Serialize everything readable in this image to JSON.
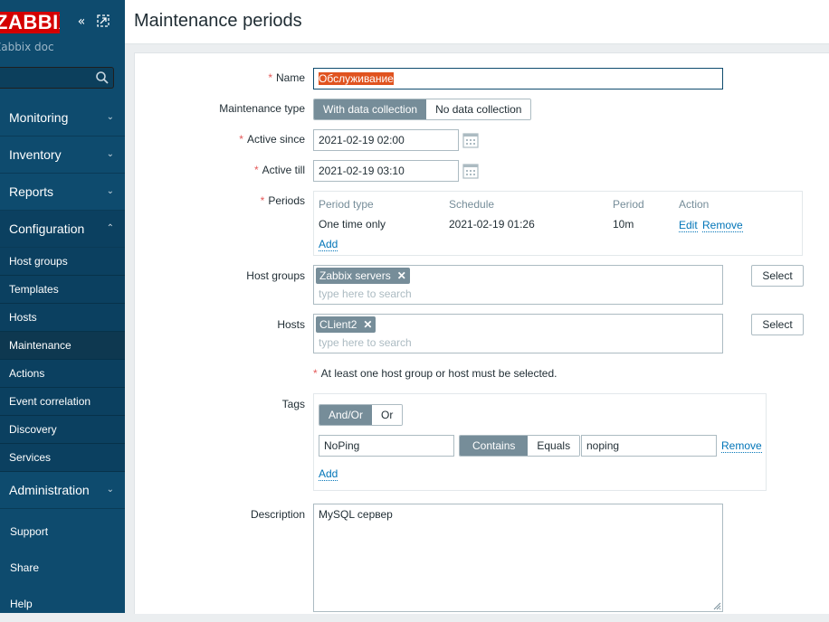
{
  "sidebar": {
    "logo": "ZABBIX",
    "server_name": "Zabbix docker",
    "menu": [
      {
        "label": "Monitoring"
      },
      {
        "label": "Inventory"
      },
      {
        "label": "Reports"
      },
      {
        "label": "Configuration"
      }
    ],
    "config_items": [
      {
        "label": "Host groups"
      },
      {
        "label": "Templates"
      },
      {
        "label": "Hosts"
      },
      {
        "label": "Maintenance"
      },
      {
        "label": "Actions"
      },
      {
        "label": "Event correlation"
      },
      {
        "label": "Discovery"
      },
      {
        "label": "Services"
      }
    ],
    "administration": "Administration",
    "bottom": [
      {
        "label": "Support"
      },
      {
        "label": "Share"
      },
      {
        "label": "Help"
      }
    ]
  },
  "header": {
    "title": "Maintenance periods"
  },
  "form": {
    "name_label": "Name",
    "name_value": "Обслуживание",
    "type_label": "Maintenance type",
    "type_options": [
      "With data collection",
      "No data collection"
    ],
    "type_selected": "With data collection",
    "since_label": "Active since",
    "since_value": "2021-02-19 02:00",
    "till_label": "Active till",
    "till_value": "2021-02-19 03:10",
    "periods_label": "Periods",
    "periods": {
      "headers": [
        "Period type",
        "Schedule",
        "Period",
        "Action"
      ],
      "rows": [
        {
          "type": "One time only",
          "schedule": "2021-02-19 01:26",
          "period": "10m",
          "edit": "Edit",
          "remove": "Remove"
        }
      ],
      "add": "Add"
    },
    "hostgroups_label": "Host groups",
    "hostgroups_chip": "Zabbix servers",
    "hostgroups_placeholder": "type here to search",
    "hosts_label": "Hosts",
    "hosts_chip": "CLient2",
    "hosts_placeholder": "type here to search",
    "select_label": "Select",
    "host_note": "At least one host group or host must be selected.",
    "tags_label": "Tags",
    "tags_eval": [
      "And/Or",
      "Or"
    ],
    "tags_eval_selected": "And/Or",
    "tag_row": {
      "tag": "NoPing",
      "operators": [
        "Contains",
        "Equals"
      ],
      "operator_selected": "Contains",
      "value": "noping",
      "remove": "Remove"
    },
    "tags_add": "Add",
    "description_label": "Description",
    "description_value": "MySQL сервер"
  },
  "colors": {
    "sidebar": "#0e4b6e",
    "logo": "#d40000",
    "segment_on": "#768d99",
    "link": "#0275b8",
    "required": "#e45959"
  }
}
